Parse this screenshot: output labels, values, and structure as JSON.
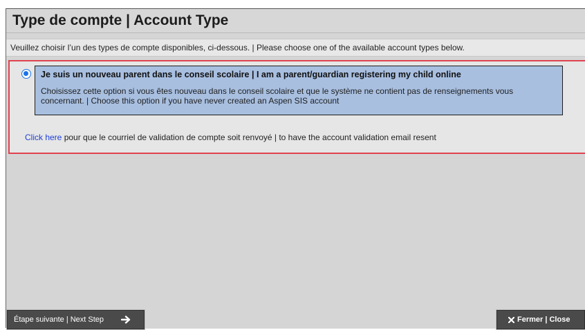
{
  "dialog": {
    "title": "Type de compte | Account Type",
    "instruction": "Veuillez choisir l’un des types de compte disponibles, ci-dessous. | Please choose one of the available account types below.",
    "option": {
      "selected": true,
      "title": "Je suis un nouveau parent dans le conseil scolaire | I am a parent/guardian registering my child online",
      "description": "Choisissez cette option si vous êtes nouveau dans le conseil scolaire et que le système ne contient pas de renseignements vous concernant. | Choose this option if you have never created an Aspen SIS account"
    },
    "resend": {
      "link_text": "Click here",
      "text": " pour que le courriel de validation de compte soit renvoyé | to have the account validation email resent"
    }
  },
  "footer": {
    "next_label": "Étape suivante | Next Step",
    "next_icon": "arrow-right-icon",
    "close_label": "Fermer | Close",
    "close_icon": "close-icon"
  },
  "colors": {
    "option_background": "#a8bfe0",
    "highlight_border": "#e0424f",
    "link": "#1f3fd6",
    "button_background": "#4a4a4a"
  }
}
